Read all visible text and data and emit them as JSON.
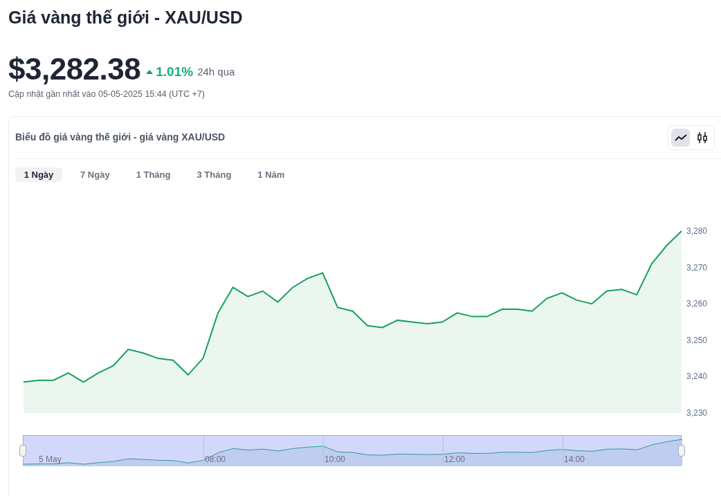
{
  "title": "Giá vàng thế giới - XAU/USD",
  "price": {
    "value": "$3,282.38",
    "change": "1.01%",
    "rising": true,
    "period": "24h qua",
    "updated": "Cập nhật gần nhất vào 05-05-2025 15:44 (UTC +7)"
  },
  "chart_card": {
    "title": "Biểu đồ giá vàng thế giới - giá vàng XAU/USD",
    "chart_types": [
      {
        "kind": "line",
        "selected": true
      },
      {
        "kind": "candlestick",
        "selected": false
      }
    ],
    "tabs": [
      {
        "label": "1 Ngày",
        "selected": true
      },
      {
        "label": "7 Ngày",
        "selected": false
      },
      {
        "label": "1 Tháng",
        "selected": false
      },
      {
        "label": "3 Tháng",
        "selected": false
      },
      {
        "label": "1 Năm",
        "selected": false
      }
    ],
    "chart_data": {
      "type": "area",
      "ylim": [
        3230,
        3280
      ],
      "yticks": [
        {
          "value": 3230,
          "label": "3,230"
        },
        {
          "value": 3240,
          "label": "3,240"
        },
        {
          "value": 3250,
          "label": "3,250"
        },
        {
          "value": 3260,
          "label": "3,260"
        },
        {
          "value": 3270,
          "label": "3,270"
        },
        {
          "value": 3280,
          "label": "3,280"
        }
      ],
      "series": [
        {
          "color": "#16a05c",
          "values": [
            3238.5,
            3239,
            3239,
            3241,
            3238.5,
            3241,
            3243,
            3247.5,
            3246.5,
            3245,
            3244.5,
            3240.5,
            3245,
            3257.5,
            3264.5,
            3262,
            3263.5,
            3260.5,
            3264.5,
            3267,
            3268.5,
            3259,
            3258,
            3254,
            3253.5,
            3255.5,
            3255,
            3254.5,
            3255,
            3257.5,
            3256.5,
            3256.5,
            3258.5,
            3258.5,
            3258,
            3261.5,
            3263,
            3261,
            3260,
            3263.5,
            3264,
            3262.5,
            3271,
            3276,
            3280
          ]
        }
      ]
    },
    "navigator": {
      "labels": [
        "5 May",
        "08:00",
        "10:00",
        "12:00",
        "14:00"
      ]
    }
  }
}
